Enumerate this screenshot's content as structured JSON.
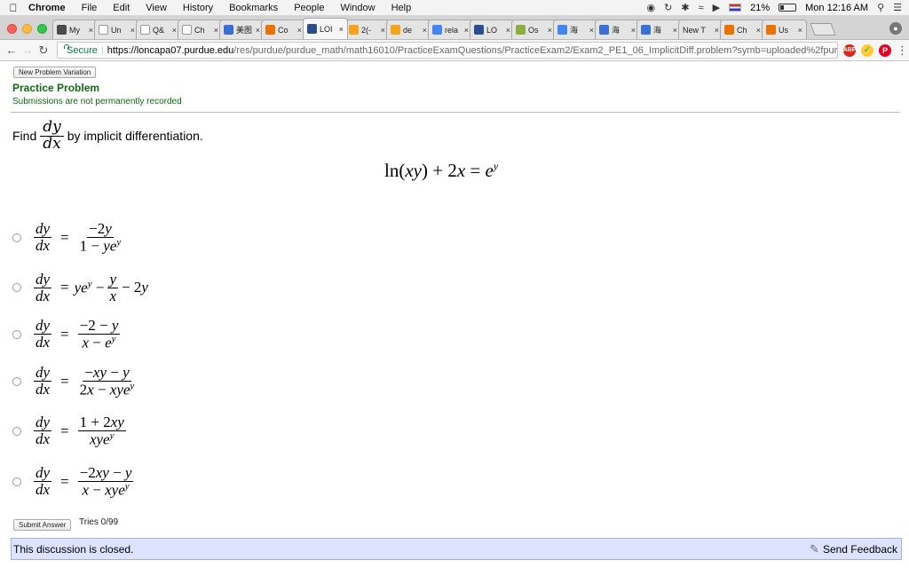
{
  "menubar": {
    "app": "Chrome",
    "items": [
      "File",
      "Edit",
      "View",
      "History",
      "Bookmarks",
      "People",
      "Window",
      "Help"
    ],
    "battery": "21%",
    "clock": "Mon 12:16 AM"
  },
  "tabs": [
    {
      "label": "My",
      "icon": "flag-icon",
      "color": "#4b4b4b"
    },
    {
      "label": "Un",
      "icon": "page-icon",
      "color": "#ffffff"
    },
    {
      "label": "Q&",
      "icon": "page-icon",
      "color": "#ffffff"
    },
    {
      "label": "Ch",
      "icon": "page-icon",
      "color": "#ffffff"
    },
    {
      "label": "美图",
      "icon": "baidu-icon",
      "color": "#3a6fd8"
    },
    {
      "label": "Co",
      "icon": "chegg-icon",
      "color": "#eb7100"
    },
    {
      "label": "LOI",
      "icon": "loncapa-icon",
      "color": "#2a4d8f",
      "active": true
    },
    {
      "label": "2(-",
      "icon": "gear-icon",
      "color": "#f4a41b"
    },
    {
      "label": "de",
      "icon": "gear-icon",
      "color": "#f4a41b"
    },
    {
      "label": "rela",
      "icon": "google-icon",
      "color": "#4285f4"
    },
    {
      "label": "LO",
      "icon": "loncapa-icon",
      "color": "#2a4d8f"
    },
    {
      "label": "Os",
      "icon": "triangle-icon",
      "color": "#8dae3c"
    },
    {
      "label": "海",
      "icon": "google-icon",
      "color": "#4285f4"
    },
    {
      "label": "海",
      "icon": "baidu-icon",
      "color": "#3a6fd8"
    },
    {
      "label": "海",
      "icon": "baidu-icon",
      "color": "#3a6fd8"
    },
    {
      "label": "New T",
      "icon": "none",
      "color": "#e4e4e4"
    },
    {
      "label": "Ch",
      "icon": "chegg-icon",
      "color": "#eb7100"
    },
    {
      "label": "Us",
      "icon": "chegg-icon",
      "color": "#eb7100"
    }
  ],
  "address": {
    "secure_label": "Secure",
    "host": "https://loncapa07.purdue.edu",
    "path": "/res/purdue/purdue_math/math16010/PracticeExamQuestions/PracticeExam2/Exam2_PE1_06_ImplicitDiff.problem?symb=uploaded%2fpur..."
  },
  "page": {
    "variation_button": "New Problem Variation",
    "title": "Practice Problem",
    "note": "Submissions are not permanently recorded",
    "question_prefix": "Find",
    "question_suffix": "by implicit differentiation.",
    "dy": "dy",
    "dx": "dx",
    "submit_button": "Submit Answer",
    "tries": "Tries 0/99",
    "discussion": "This discussion is closed.",
    "feedback": "Send Feedback"
  }
}
